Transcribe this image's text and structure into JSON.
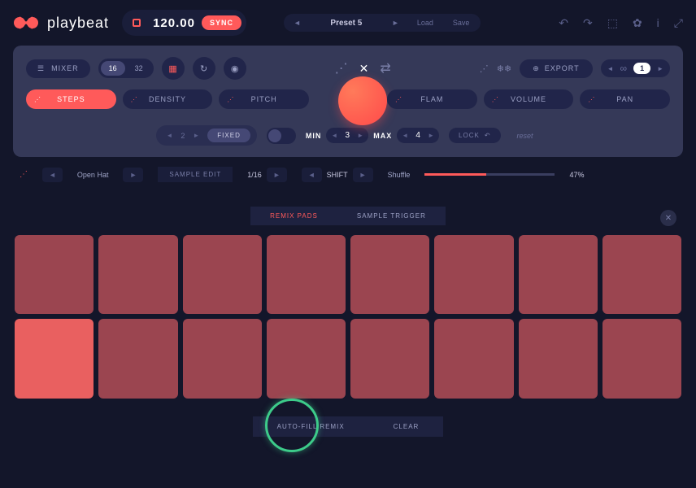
{
  "app": {
    "name": "playbeat"
  },
  "tempo": {
    "value": "120.00",
    "sync": "SYNC"
  },
  "preset": {
    "name": "Preset 5",
    "load": "Load",
    "save": "Save"
  },
  "toolbar": {
    "mixer": "MIXER",
    "steps16": "16",
    "steps32": "32",
    "export": "EXPORT",
    "loop_count": "1"
  },
  "params": {
    "steps": "STEPS",
    "density": "DENSITY",
    "pitch": "PITCH",
    "flam": "FLAM",
    "volume": "VOLUME",
    "pan": "PAN"
  },
  "fixed": {
    "value": "2",
    "label": "FIXED"
  },
  "range": {
    "min_label": "MIN",
    "min_value": "3",
    "max_label": "MAX",
    "max_value": "4"
  },
  "lock": "LOCK",
  "reset": "reset",
  "sample": {
    "name": "Open Hat",
    "edit": "SAMPLE EDIT",
    "division": "1/16",
    "shift": "SHIFT",
    "shuffle_label": "Shuffle",
    "shuffle_pct": "47%"
  },
  "tabs": {
    "remix": "REMIX PADS",
    "trigger": "SAMPLE TRIGGER"
  },
  "bottom": {
    "autofill": "AUTO-FILL REMIX",
    "clear": "CLEAR"
  },
  "pads": {
    "bright_index": 8
  }
}
